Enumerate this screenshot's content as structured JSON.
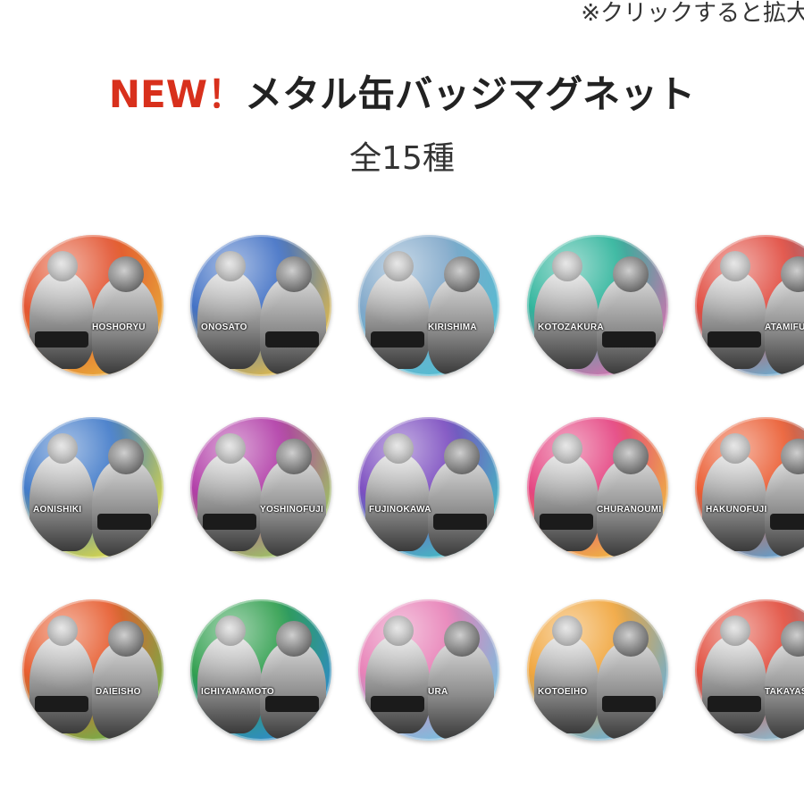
{
  "header": {
    "note": "※クリックすると拡大",
    "title_new": "NEW！",
    "title_main": "メタル缶バッジマグネット",
    "subtitle": "全15種"
  },
  "badges": [
    {
      "name": "HOSHORYU",
      "color": "#e2532f",
      "color2": "#e9b23a"
    },
    {
      "name": "ONOSATO",
      "color": "#3f6fc4",
      "color2": "#f1c23e"
    },
    {
      "name": "KIRISHIMA",
      "color": "#7fa7c9",
      "color2": "#4fbfd3"
    },
    {
      "name": "KOTOZAKURA",
      "color": "#2cb39a",
      "color2": "#e26bb1"
    },
    {
      "name": "ATAMIFUJI",
      "color": "#e0493d",
      "color2": "#5bb8e3"
    },
    {
      "name": "AONISHIKI",
      "color": "#3e78c8",
      "color2": "#e9e23a"
    },
    {
      "name": "YOSHINOFUJI",
      "color": "#b03aa6",
      "color2": "#9bd45a"
    },
    {
      "name": "FUJINOKAWA",
      "color": "#7a4bbf",
      "color2": "#3ec6c4"
    },
    {
      "name": "CHURANOUMI",
      "color": "#e4417f",
      "color2": "#f0c23b"
    },
    {
      "name": "HAKUNOFUJI",
      "color": "#ea5a2f",
      "color2": "#4fa7e0"
    },
    {
      "name": "DAIEISHO",
      "color": "#e65a2c",
      "color2": "#68b74a"
    },
    {
      "name": "ICHIYAMAMOTO",
      "color": "#2f9e4d",
      "color2": "#2f8ad6"
    },
    {
      "name": "URA",
      "color": "#e77fb6",
      "color2": "#6cc6e4"
    },
    {
      "name": "KOTOEIHO",
      "color": "#f0a43a",
      "color2": "#5fb0e2"
    },
    {
      "name": "TAKAYASU",
      "color": "#e14b3b",
      "color2": "#7fc8e2"
    }
  ]
}
